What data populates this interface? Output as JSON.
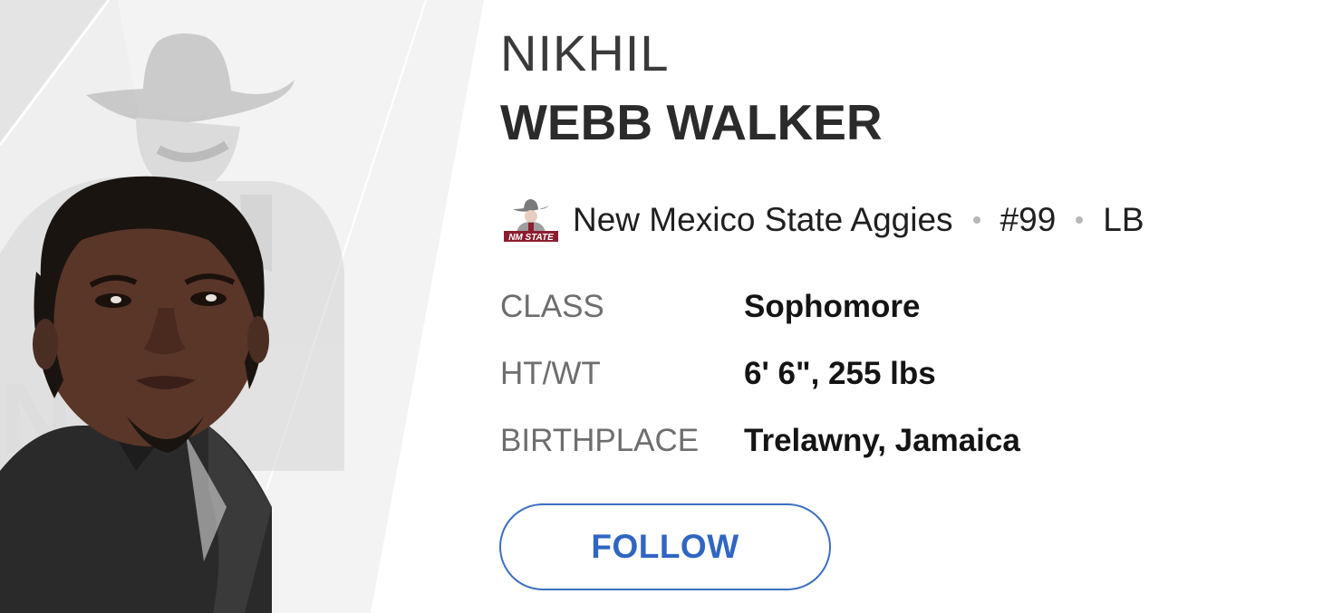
{
  "player": {
    "first_name": "NIKHIL",
    "last_name": "WEBB WALKER",
    "photo_icon": "player-headshot",
    "background_logo_icon": "cowboy-mascot-watermark"
  },
  "team": {
    "logo_icon": "nm-state-aggies-logo",
    "logo_text": "NM STATE",
    "name": "New Mexico State Aggies",
    "jersey": "#99",
    "position": "LB"
  },
  "facts": [
    {
      "label": "CLASS",
      "value": "Sophomore"
    },
    {
      "label": "HT/WT",
      "value": "6' 6\", 255 lbs"
    },
    {
      "label": "BIRTHPLACE",
      "value": "Trelawny, Jamaica"
    }
  ],
  "actions": {
    "follow_label": "FOLLOW"
  },
  "colors": {
    "follow_accent": "#2f66c2",
    "separator_dot": "#b8b8b8",
    "team_crimson": "#8c1d2f"
  }
}
